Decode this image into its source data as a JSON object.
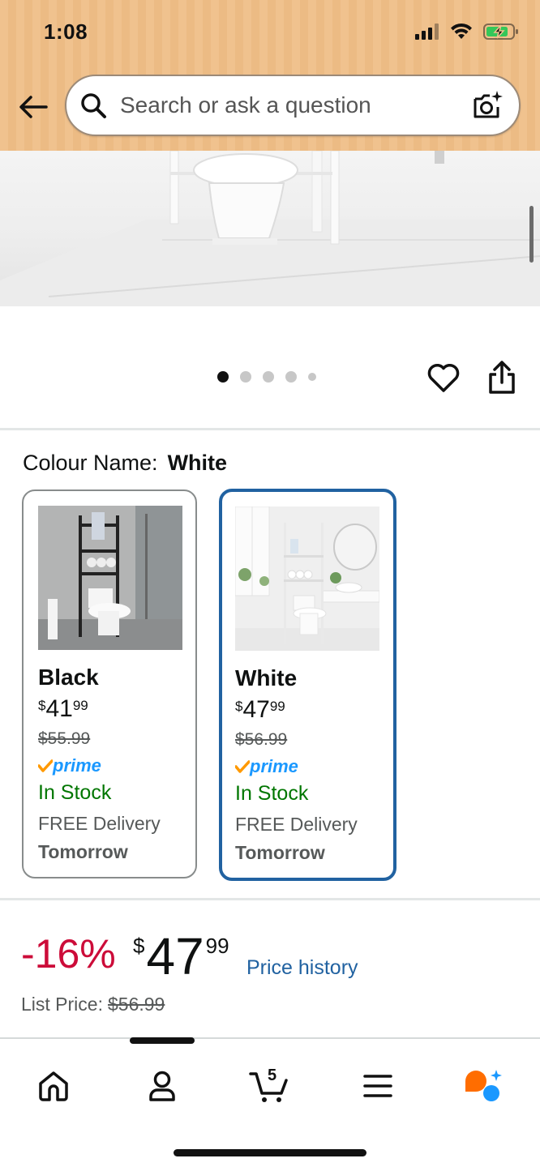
{
  "status_bar": {
    "time": "1:08"
  },
  "search": {
    "placeholder": "Search or ask a question"
  },
  "gallery": {
    "dot_count": 5,
    "active_index": 0
  },
  "colour": {
    "label": "Colour Name:",
    "selected": "White"
  },
  "variants": [
    {
      "name": "Black",
      "price_symbol": "$",
      "price_whole": "41",
      "price_fraction": "99",
      "was_price": "$55.99",
      "prime_label": "prime",
      "availability": "In Stock",
      "delivery": "FREE Delivery",
      "delivery_day": "Tomorrow",
      "selected": false
    },
    {
      "name": "White",
      "price_symbol": "$",
      "price_whole": "47",
      "price_fraction": "99",
      "was_price": "$56.99",
      "prime_label": "prime",
      "availability": "In Stock",
      "delivery": "FREE Delivery",
      "delivery_day": "Tomorrow",
      "selected": true
    }
  ],
  "pricing": {
    "discount": "-16%",
    "symbol": "$",
    "whole": "47",
    "fraction": "99",
    "price_history_link": "Price history",
    "list_price_label": "List Price:",
    "list_price_value": "$56.99"
  },
  "bottom_nav": {
    "items": [
      "home-icon",
      "account-icon",
      "cart-icon",
      "menu-icon",
      "rufus-ai-icon"
    ],
    "cart_count": "5"
  },
  "colors": {
    "header_bg": "#f0c28e",
    "link_blue": "#2162a1",
    "discount_red": "#cc0c39",
    "in_stock_green": "#007600",
    "prime_blue": "#1a98ff",
    "prime_check_orange": "#ff9900",
    "rufus_orange": "#ff6d00",
    "rufus_blue": "#1a98ff"
  }
}
